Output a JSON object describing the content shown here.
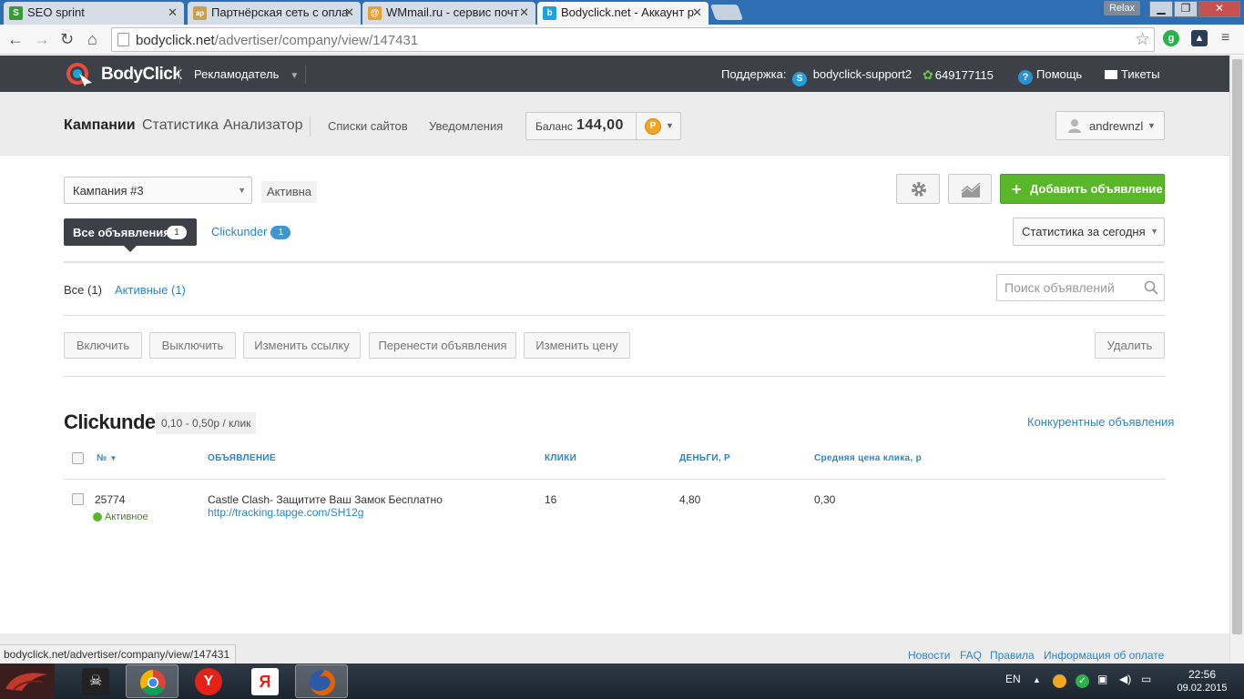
{
  "browser": {
    "tabs": [
      {
        "title": "SEO sprint",
        "fav_color": "#3a9a3a",
        "fav_glyph": "S",
        "active": false
      },
      {
        "title": "Партнёрская сеть с опла",
        "fav_color": "#c8a050",
        "fav_glyph": "ap",
        "active": false
      },
      {
        "title": "WMmail.ru - сервис почт",
        "fav_color": "#e8a030",
        "fav_glyph": "@",
        "active": false
      },
      {
        "title": "Bodyclick.net - Аккаунт р",
        "fav_color": "#1ea1e0",
        "fav_glyph": "b",
        "active": true
      }
    ],
    "relax_label": "Relax",
    "url_domain": "bodyclick.net",
    "url_path": "/advertiser/company/view/147431",
    "status_url": "bodyclick.net/advertiser/company/view/147431"
  },
  "site_header": {
    "logo_text": "BodyClick",
    "role": "Рекламодатель",
    "support_label": "Поддержка:",
    "skype": "bodyclick-support2",
    "icq": "649177115",
    "help": "Помощь",
    "tickets": "Тикеты"
  },
  "main_nav": {
    "campaigns": "Кампании",
    "statistics": "Статистика",
    "analyzer": "Анализатор",
    "site_lists": "Списки сайтов",
    "notifications": "Уведомления",
    "balance_label": "Баланс",
    "balance_value": "144,00",
    "currency_glyph": "Р",
    "username": "andrewnzl"
  },
  "campaign": {
    "selected": "Кампания #3",
    "status": "Активна",
    "add_ad_label": "Добавить объявление",
    "stats_period": "Статистика за сегодня"
  },
  "ad_tabs": {
    "all_label": "Все объявления",
    "all_count": "1",
    "clickunder_label": "Clickunder",
    "clickunder_count": "1"
  },
  "filters": {
    "all": "Все (1)",
    "active": "Активные (1)",
    "search_placeholder": "Поиск объявлений"
  },
  "actions": {
    "enable": "Включить",
    "disable": "Выключить",
    "change_link": "Изменить ссылку",
    "move_ads": "Перенести объявления",
    "change_price": "Изменить цену",
    "delete": "Удалить"
  },
  "section": {
    "title": "Clickunder",
    "price": "0,10 - 0,50р / клик",
    "competitors_link": "Конкурентные объявления"
  },
  "table": {
    "headers": {
      "num": "№",
      "ad": "Объявление",
      "clicks": "Клики",
      "money": "Деньги, р",
      "avg_cpc": "Средняя цена клика, р"
    },
    "rows": [
      {
        "id": "25774",
        "status": "Активное",
        "title": "Castle Clash- Защитите Ваш Замок Бесплатно",
        "url": "http://tracking.tapge.com/SH12g",
        "clicks": "16",
        "money": "4,80",
        "avg_cpc": "0,30"
      }
    ]
  },
  "footer": {
    "news": "Новости",
    "faq": "FAQ",
    "rules": "Правила",
    "payment_info": "Информация об оплате"
  },
  "taskbar": {
    "lang": "EN",
    "time": "22:56",
    "date": "09.02.2015"
  },
  "colors": {
    "accent_link": "#2a86c7",
    "add_button": "#5ab72a",
    "header_dark": "#3d4147"
  }
}
